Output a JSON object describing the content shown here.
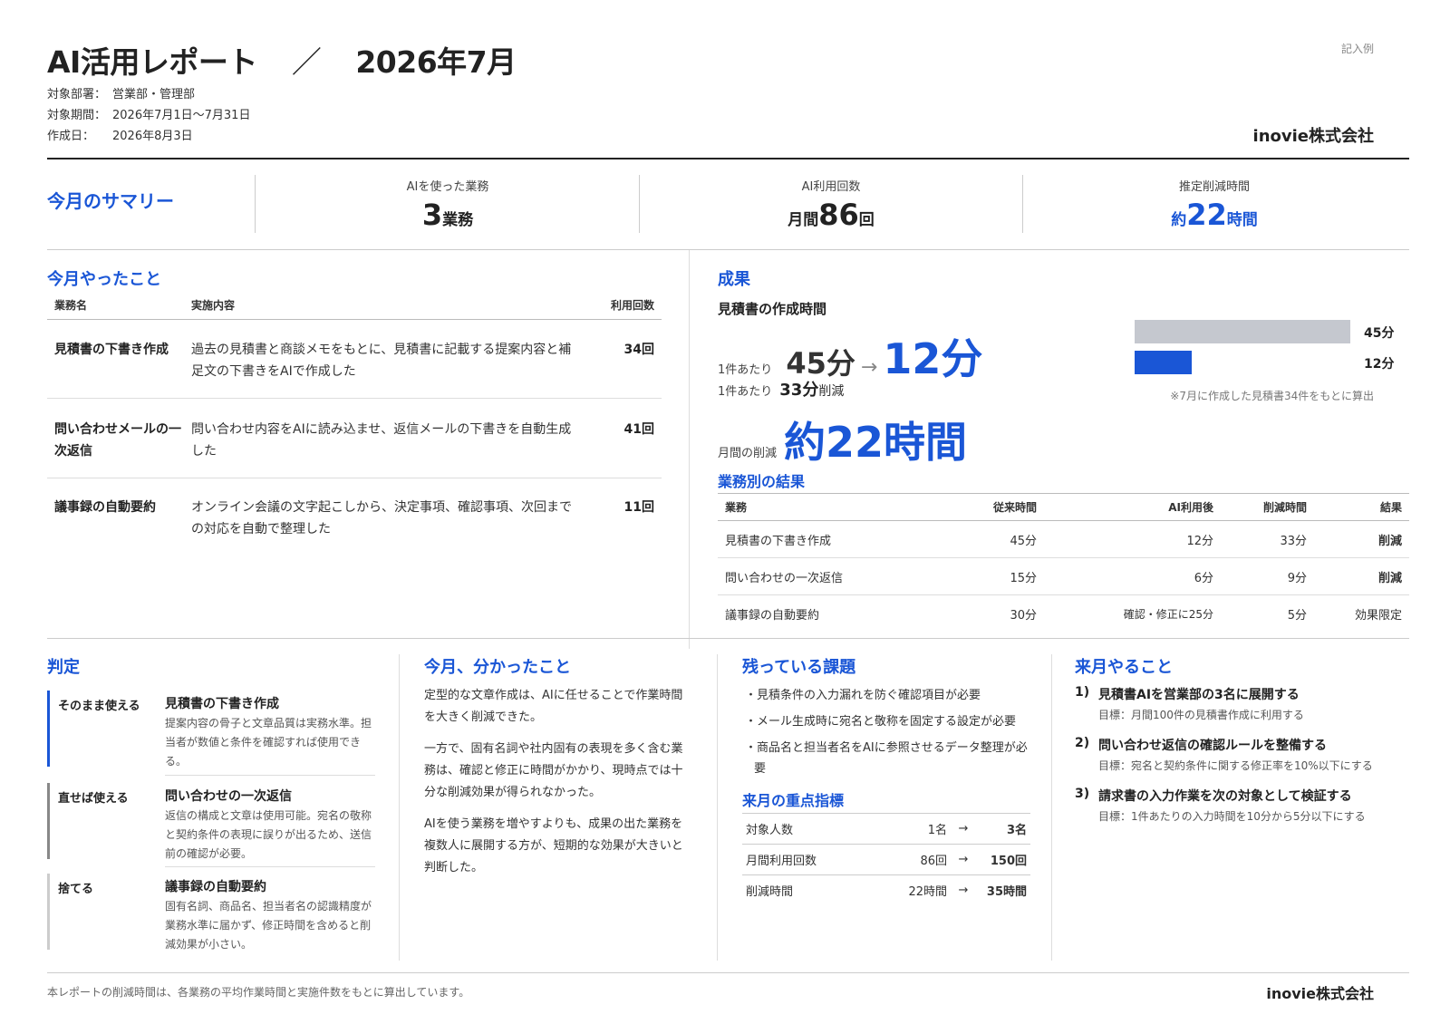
{
  "header": {
    "title_main": "AI活用レポート",
    "title_sep": "／",
    "title_period": "2026年7月",
    "meta": [
      {
        "key": "対象部署：",
        "value": "営業部・管理部"
      },
      {
        "key": "対象期間：",
        "value": "2026年7月1日〜7月31日"
      },
      {
        "key": "作成日：",
        "value": "2026年8月3日"
      }
    ],
    "sample_label": "記入例",
    "company": "inovie株式会社"
  },
  "summary": {
    "title": "今月のサマリー",
    "cells": [
      {
        "label": "AIを使った業務",
        "prefix": "",
        "value": "3",
        "suffix": "業務"
      },
      {
        "label": "AI利用回数",
        "prefix": "月間",
        "value": "86",
        "suffix": "回"
      },
      {
        "label": "推定削減時間",
        "prefix": "約",
        "value": "22",
        "suffix": "時間"
      }
    ]
  },
  "tasks": {
    "title": "今月やったこと",
    "headers": {
      "name": "業務名",
      "desc": "実施内容",
      "count": "利用回数"
    },
    "rows": [
      {
        "name": "見積書の下書き作成",
        "desc": "過去の見積書と商談メモをもとに、見積書に記載する提案内容と補足文の下書きをAIで作成した",
        "count": "34回"
      },
      {
        "name": "問い合わせメールの一次返信",
        "desc": "問い合わせ内容をAIに読み込ませ、返信メールの下書きを自動生成した",
        "count": "41回"
      },
      {
        "name": "議事録の自動要約",
        "desc": "オンライン会議の文字起こしから、決定事項、確認事項、次回までの対応を自動で整理した",
        "count": "11回"
      }
    ]
  },
  "results": {
    "title": "成果",
    "subtitle": "見積書の作成時間",
    "per_label": "1件あたり",
    "before": "45分",
    "arrow": "→",
    "after": "12分",
    "per_label2": "1件あたり",
    "reduce_value": "33分",
    "reduce_suffix": "削減",
    "monthly_label": "月間の削減",
    "monthly_value": "約22時間",
    "bars": [
      {
        "label": "45分",
        "minutes": 45,
        "color": "#c5c8cf"
      },
      {
        "label": "12分",
        "minutes": 12,
        "color": "#1a56d6"
      }
    ],
    "bar_note": "※7月に作成した見積書34件をもとに算出"
  },
  "by_job": {
    "title": "業務別の結果",
    "headers": [
      "業務",
      "従来時間",
      "AI利用後",
      "削減時間",
      "結果"
    ],
    "rows": [
      {
        "job": "見積書の下書き作成",
        "before": "45分",
        "after": "12分",
        "saved": "33分",
        "result": "削減",
        "kind": "good"
      },
      {
        "job": "問い合わせの一次返信",
        "before": "15分",
        "after": "6分",
        "saved": "9分",
        "result": "削減",
        "kind": "good"
      },
      {
        "job": "議事録の自動要約",
        "before": "30分",
        "after": "確認・修正に25分",
        "saved": "5分",
        "result": "効果限定",
        "kind": "limited"
      }
    ]
  },
  "judgement": {
    "title": "判定",
    "items": [
      {
        "label": "そのまま使える",
        "name": "見積書の下書き作成",
        "desc": "提案内容の骨子と文章品質は実務水準。担当者が数値と条件を確認すれば使用できる。",
        "color": "#1a56d6"
      },
      {
        "label": "直せば使える",
        "name": "問い合わせの一次返信",
        "desc": "返信の構成と文章は使用可能。宛名の敬称と契約条件の表現に誤りが出るため、送信前の確認が必要。",
        "color": "#888888"
      },
      {
        "label": "捨てる",
        "name": "議事録の自動要約",
        "desc": "固有名詞、商品名、担当者名の認識精度が業務水準に届かず、修正時間を含めると削減効果が小さい。",
        "color": "#cccccc"
      }
    ]
  },
  "learnings": {
    "title": "今月、分かったこと",
    "paragraphs": [
      "定型的な文章作成は、AIに任せることで作業時間を大きく削減できた。",
      "一方で、固有名詞や社内固有の表現を多く含む業務は、確認と修正に時間がかかり、現時点では十分な削減効果が得られなかった。",
      "AIを使う業務を増やすよりも、成果の出た業務を複数人に展開する方が、短期的な効果が大きいと判断した。"
    ]
  },
  "issues": {
    "title": "残っている課題",
    "items": [
      "・見積条件の入力漏れを防ぐ確認項目が必要",
      "・メール生成時に宛名と敬称を固定する設定が必要",
      "・商品名と担当者名をAIに参照させるデータ整理が必要"
    ]
  },
  "kpi": {
    "title": "来月の重点指標",
    "rows": [
      {
        "name": "対象人数",
        "from": "1名",
        "arrow": "→",
        "to": "3名"
      },
      {
        "name": "月間利用回数",
        "from": "86回",
        "arrow": "→",
        "to": "150回"
      },
      {
        "name": "削減時間",
        "from": "22時間",
        "arrow": "→",
        "to": "35時間"
      }
    ]
  },
  "next": {
    "title": "来月やること",
    "items": [
      {
        "num": "1)",
        "main": "見積書AIを営業部の3名に展開する",
        "sub": "目標：月間100件の見積書作成に利用する"
      },
      {
        "num": "2)",
        "main": "問い合わせ返信の確認ルールを整備する",
        "sub": "目標：宛名と契約条件に関する修正率を10%以下にする"
      },
      {
        "num": "3)",
        "main": "請求書の入力作業を次の対象として検証する",
        "sub": "目標：1件あたりの入力時間を10分から5分以下にする"
      }
    ]
  },
  "footer": {
    "note": "本レポートの削減時間は、各業務の平均作業時間と実施件数をもとに算出しています。",
    "company": "inovie株式会社"
  }
}
